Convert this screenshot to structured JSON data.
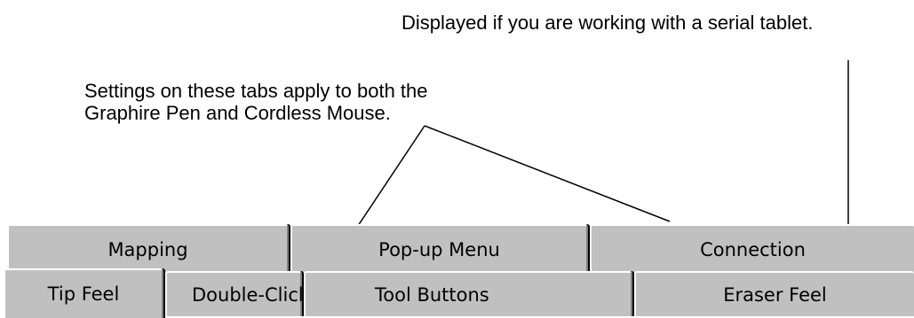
{
  "callouts": {
    "serial_tablet": "Displayed if you are working with a serial tablet.",
    "shared_settings_line1": "Settings on these tabs apply to both the",
    "shared_settings_line2": "Graphire Pen and Cordless Mouse."
  },
  "tabs": {
    "back_row": [
      {
        "label": "Mapping"
      },
      {
        "label": "Pop-up Menu"
      },
      {
        "label": "Connection"
      }
    ],
    "front_row": [
      {
        "label": "Tip Feel",
        "selected": true
      },
      {
        "label": "Double-Click"
      },
      {
        "label": "Tool Buttons"
      },
      {
        "label": "Eraser Feel"
      }
    ]
  },
  "colors": {
    "tab_face": "#c0c0c0",
    "highlight": "#ffffff",
    "shadow": "#808080",
    "text": "#000000"
  }
}
